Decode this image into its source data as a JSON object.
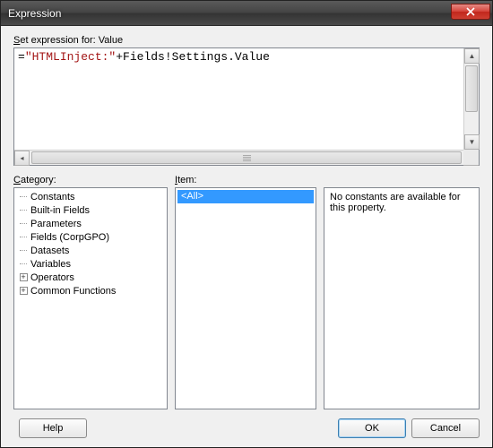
{
  "window": {
    "title": "Expression"
  },
  "labels": {
    "set_expression_for": "Set expression for: Value",
    "category": "Category:",
    "item": "Item:"
  },
  "expression": {
    "eq": "=",
    "str": "\"HTMLInject:\"",
    "plus": "+",
    "rest": "Fields!Settings.Value"
  },
  "categories": [
    {
      "label": "Constants",
      "expandable": false
    },
    {
      "label": "Built-in Fields",
      "expandable": false
    },
    {
      "label": "Parameters",
      "expandable": false
    },
    {
      "label": "Fields (CorpGPO)",
      "expandable": false
    },
    {
      "label": "Datasets",
      "expandable": false
    },
    {
      "label": "Variables",
      "expandable": false
    },
    {
      "label": "Operators",
      "expandable": true
    },
    {
      "label": "Common Functions",
      "expandable": true
    }
  ],
  "items": [
    {
      "label": "<All>",
      "selected": true
    }
  ],
  "description": "No constants are available for this property.",
  "buttons": {
    "help": "Help",
    "ok": "OK",
    "cancel": "Cancel"
  }
}
